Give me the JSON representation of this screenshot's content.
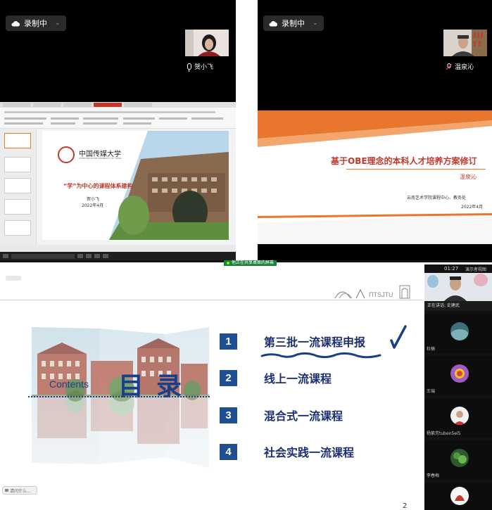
{
  "panels": {
    "left": {
      "recording_label": "录制中",
      "participant_name": "贺小飞",
      "slide": {
        "university_logo_text": "中国传媒大学",
        "university_english": "COMMUNICATION UNIVERSITY OF CHINA",
        "title": "“学”为中心的课程体系建构",
        "presenter": "贺小飞",
        "date": "2022年4月"
      }
    },
    "right": {
      "recording_label": "录制中",
      "participant_name": "温泉沁",
      "slide": {
        "title": "基于OBE理念的本科人才培养方案修订",
        "presenter": "温泉沁",
        "org": "云南艺术学院课程中心、教务处",
        "date": "2022年4月"
      }
    }
  },
  "main": {
    "sharing_banner": "他正在共享桌面的屏幕",
    "contents_label": "Contents",
    "mulu": "目录",
    "toc": [
      {
        "num": "1",
        "text": "第三批一流课程申报"
      },
      {
        "num": "2",
        "text": "线上一流课程"
      },
      {
        "num": "3",
        "text": "混合式一流课程"
      },
      {
        "num": "4",
        "text": "社会实践一流课程"
      }
    ],
    "page_number": "2",
    "bottom_button": "请问什么..."
  },
  "sidebar": {
    "time": "01:27",
    "view_label": "演示者视图",
    "speaker_label": "正在讲话: 史建武",
    "participants": [
      {
        "name": "杜楠"
      },
      {
        "name": "王瑞"
      },
      {
        "name": "杨紫芳tuben5el5"
      },
      {
        "name": "李春梅"
      }
    ]
  },
  "colors": {
    "accent_blue": "#1f4e93",
    "title_red": "#c0392b",
    "orange_band": "#e8762c"
  }
}
